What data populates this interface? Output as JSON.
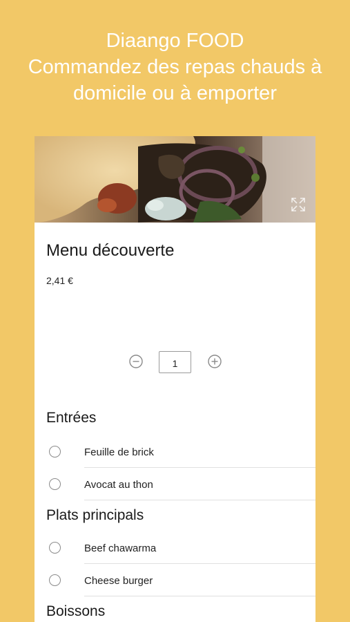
{
  "header": {
    "line1": "Diaango FOOD",
    "line2": "Commandez des repas chauds à",
    "line3": "domicile ou à emporter"
  },
  "menu": {
    "title": "Menu découverte",
    "price": "2,41 €",
    "quantity": "1",
    "hero_icon": "expand-icon"
  },
  "sections": [
    {
      "heading": "Entrées",
      "options": [
        "Feuille de brick",
        "Avocat au thon"
      ]
    },
    {
      "heading": "Plats principals",
      "options": [
        "Beef chawarma",
        "Cheese burger"
      ]
    },
    {
      "heading": "Boissons",
      "options": []
    }
  ],
  "colors": {
    "background": "#F2C867",
    "card": "#FFFFFF",
    "icon_gray": "#8A8A8A"
  }
}
